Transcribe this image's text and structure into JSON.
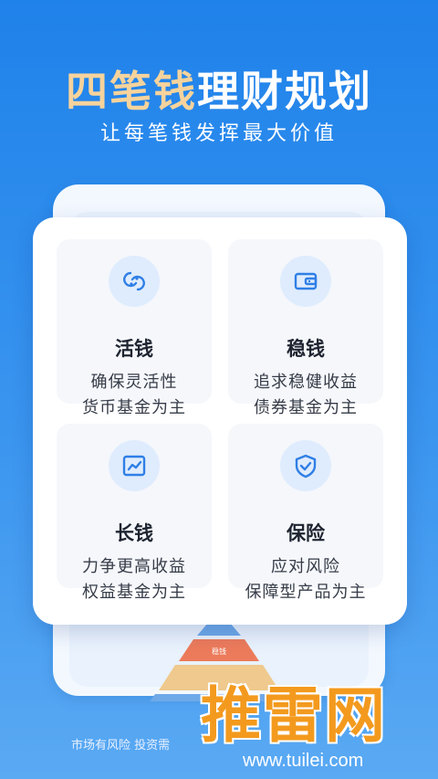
{
  "hero": {
    "title_gold": "四笔钱",
    "title_white": "理财规划",
    "subtitle": "让每笔钱发挥最大价值"
  },
  "tiles": [
    {
      "icon": "link-coins-icon",
      "title": "活钱",
      "line1": "确保灵活性",
      "line2": "货币基金为主"
    },
    {
      "icon": "wallet-icon",
      "title": "稳钱",
      "line1": "追求稳健收益",
      "line2": "债券基金为主"
    },
    {
      "icon": "chart-trend-icon",
      "title": "长钱",
      "line1": "力争更高收益",
      "line2": "权益基金为主"
    },
    {
      "icon": "shield-check-icon",
      "title": "保险",
      "line1": "应对风险",
      "line2": "保障型产品为主"
    }
  ],
  "pyramid": {
    "label": "稳钱"
  },
  "disclaimer": "市场有风险 投资需",
  "watermark": {
    "text": "推雷网",
    "url": "www.tuilei.com"
  },
  "colors": {
    "accent": "#1f82ea",
    "gold": "#f6d39c",
    "icon_blue": "#2f7fe6",
    "watermark": "#f39a1e"
  }
}
